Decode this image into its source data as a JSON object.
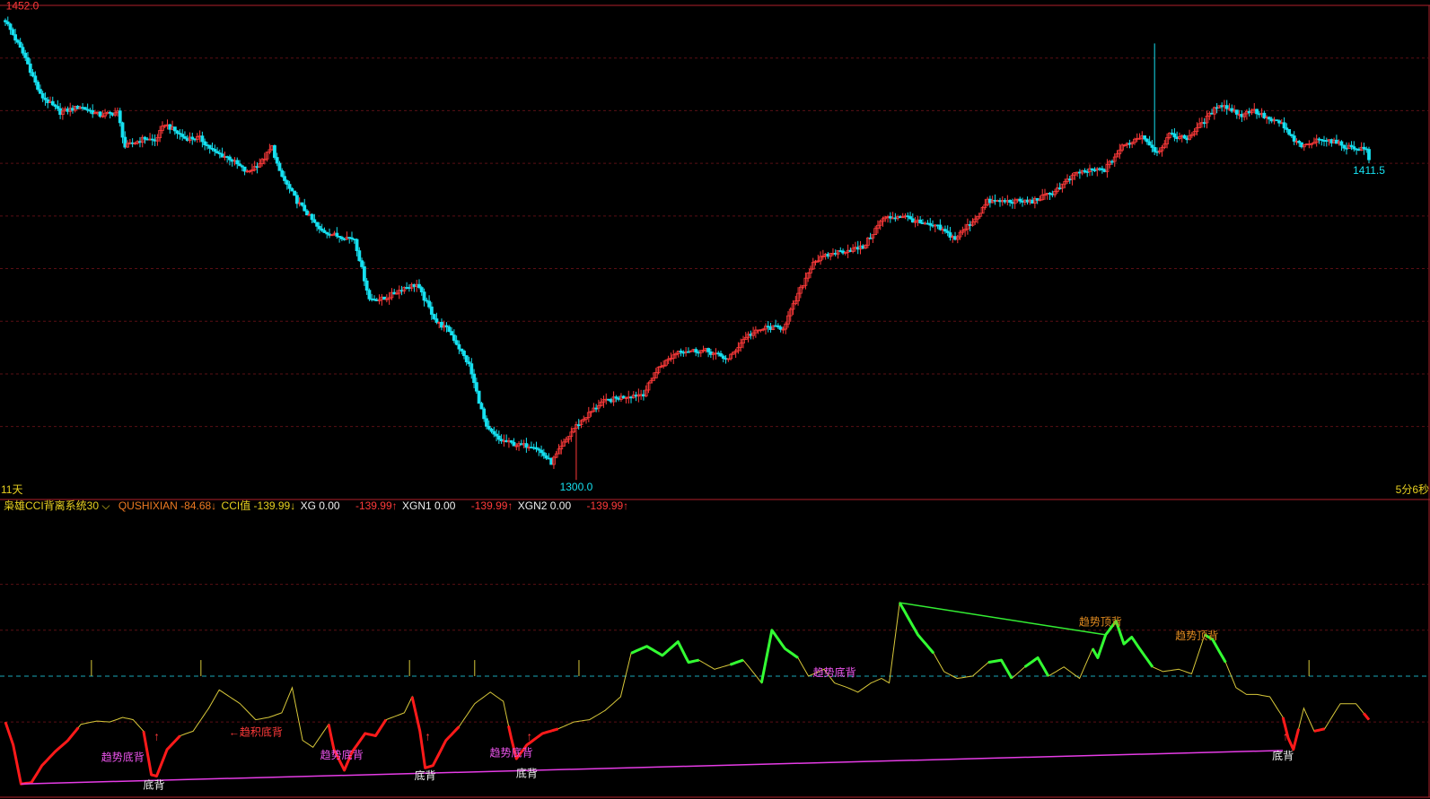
{
  "colors": {
    "background": "#000000",
    "frame": "#b0202a",
    "grid": "#5a0f14",
    "up": "#ff3a3a",
    "down": "#16e0f0",
    "cci_line": "#d8c83a",
    "cci_red": "#ff1a1a",
    "cci_green": "#33ff33",
    "pink_line": "#e63ce6",
    "green_line": "#33ee33",
    "zero_line": "#1aa9b8",
    "label_pink": "#ee55ee",
    "label_orange": "#e08a20",
    "label_white": "#f0f0f0",
    "label_red": "#ff3a3a",
    "label_cyan": "#16e0f0",
    "label_yellow": "#e8d020"
  },
  "main_panel": {
    "period_label": "11天",
    "countdown_label": "5分6秒",
    "high_label": "1452.0",
    "low_label": "1300.0",
    "last_label": "1411.5"
  },
  "indicator_legend": {
    "name": "枭雄CCI背离系统30",
    "items": [
      {
        "text": "QUSHIXIAN -84.68↓",
        "color": "#ee7a22"
      },
      {
        "text": "CCI值 -139.99↓",
        "color": "#e8d020"
      },
      {
        "text": "XG 0.00",
        "color": "#f0f0f0"
      },
      {
        "text": "-139.99↑",
        "color": "#ff3a3a"
      },
      {
        "text": "XGN1 0.00",
        "color": "#f0f0f0"
      },
      {
        "text": "-139.99↑",
        "color": "#ff3a3a"
      },
      {
        "text": "XGN2 0.00",
        "color": "#f0f0f0"
      },
      {
        "text": "-139.99↑",
        "color": "#ff3a3a"
      }
    ]
  },
  "chart_data": [
    {
      "type": "candlestick",
      "ylim": [
        1296,
        1464
      ],
      "high_marker": 1452.0,
      "low_marker": 1300.0,
      "last_marker": 1411.5,
      "anchors": [
        [
          0,
          1460
        ],
        [
          8,
          1447
        ],
        [
          14,
          1434
        ],
        [
          22,
          1428
        ],
        [
          30,
          1430
        ],
        [
          38,
          1427
        ],
        [
          45,
          1428
        ],
        [
          48,
          1416
        ],
        [
          56,
          1419
        ],
        [
          60,
          1418
        ],
        [
          64,
          1424
        ],
        [
          72,
          1419
        ],
        [
          78,
          1419
        ],
        [
          84,
          1414
        ],
        [
          90,
          1412
        ],
        [
          97,
          1407
        ],
        [
          103,
          1411
        ],
        [
          107,
          1416
        ],
        [
          110,
          1407
        ],
        [
          117,
          1397
        ],
        [
          120,
          1394
        ],
        [
          126,
          1387
        ],
        [
          133,
          1385
        ],
        [
          140,
          1384
        ],
        [
          146,
          1363
        ],
        [
          152,
          1363
        ],
        [
          160,
          1367
        ],
        [
          165,
          1368
        ],
        [
          173,
          1355
        ],
        [
          178,
          1352
        ],
        [
          186,
          1340
        ],
        [
          193,
          1318
        ],
        [
          198,
          1314
        ],
        [
          206,
          1312
        ],
        [
          212,
          1312
        ],
        [
          219,
          1306
        ],
        [
          228,
          1318
        ],
        [
          234,
          1323
        ],
        [
          239,
          1327
        ],
        [
          248,
          1329
        ],
        [
          256,
          1330
        ],
        [
          262,
          1339
        ],
        [
          270,
          1345
        ],
        [
          274,
          1345
        ],
        [
          281,
          1345
        ],
        [
          290,
          1342
        ],
        [
          297,
          1350
        ],
        [
          305,
          1353
        ],
        [
          312,
          1353
        ],
        [
          324,
          1376
        ],
        [
          332,
          1379
        ],
        [
          338,
          1380
        ],
        [
          344,
          1381
        ],
        [
          352,
          1391
        ],
        [
          360,
          1392
        ],
        [
          368,
          1389
        ],
        [
          374,
          1388
        ],
        [
          381,
          1384
        ],
        [
          389,
          1391
        ],
        [
          394,
          1397
        ],
        [
          400,
          1397
        ],
        [
          404,
          1397
        ],
        [
          412,
          1397
        ],
        [
          420,
          1400
        ],
        [
          430,
          1407
        ],
        [
          438,
          1408
        ],
        [
          441,
          1408
        ],
        [
          448,
          1416
        ],
        [
          456,
          1420
        ],
        [
          462,
          1414
        ],
        [
          467,
          1420
        ],
        [
          474,
          1419
        ],
        [
          482,
          1426
        ],
        [
          487,
          1431
        ],
        [
          496,
          1427
        ],
        [
          500,
          1429
        ],
        [
          508,
          1425
        ],
        [
          512,
          1424
        ],
        [
          517,
          1418
        ],
        [
          521,
          1416
        ],
        [
          528,
          1419
        ],
        [
          532,
          1418
        ],
        [
          538,
          1416
        ],
        [
          547,
          1415
        ]
      ]
    },
    {
      "type": "line",
      "ylim": [
        -260,
        340
      ],
      "anchors": [
        [
          0,
          -100
        ],
        [
          3,
          -150
        ],
        [
          6,
          -235
        ],
        [
          10,
          -232
        ],
        [
          14,
          -195
        ],
        [
          19,
          -165
        ],
        [
          24,
          -140
        ],
        [
          29,
          -105
        ],
        [
          35,
          -98
        ],
        [
          40,
          -100
        ],
        [
          45,
          -90
        ],
        [
          49,
          -95
        ],
        [
          53,
          -120
        ],
        [
          56,
          -215
        ],
        [
          58,
          -218
        ],
        [
          62,
          -160
        ],
        [
          67,
          -130
        ],
        [
          72,
          -120
        ],
        [
          78,
          -70
        ],
        [
          82,
          -30
        ],
        [
          86,
          -45
        ],
        [
          90,
          -60
        ],
        [
          96,
          -95
        ],
        [
          101,
          -90
        ],
        [
          106,
          -80
        ],
        [
          110,
          -25
        ],
        [
          114,
          -140
        ],
        [
          118,
          -155
        ],
        [
          124,
          -105
        ],
        [
          126,
          -160
        ],
        [
          130,
          -205
        ],
        [
          133,
          -165
        ],
        [
          138,
          -125
        ],
        [
          142,
          -130
        ],
        [
          146,
          -95
        ],
        [
          153,
          -80
        ],
        [
          156,
          -45
        ],
        [
          159,
          -120
        ],
        [
          161,
          -200
        ],
        [
          164,
          -195
        ],
        [
          169,
          -140
        ],
        [
          174,
          -110
        ],
        [
          180,
          -60
        ],
        [
          186,
          -35
        ],
        [
          191,
          -55
        ],
        [
          194,
          -135
        ],
        [
          196,
          -180
        ],
        [
          200,
          -150
        ],
        [
          206,
          -125
        ],
        [
          212,
          -115
        ],
        [
          218,
          -100
        ],
        [
          224,
          -95
        ],
        [
          230,
          -75
        ],
        [
          236,
          -45
        ],
        [
          240,
          50
        ],
        [
          246,
          65
        ],
        [
          252,
          45
        ],
        [
          258,
          75
        ],
        [
          262,
          30
        ],
        [
          266,
          35
        ],
        [
          272,
          15
        ],
        [
          278,
          25
        ],
        [
          283,
          35
        ],
        [
          288,
          0
        ],
        [
          290,
          -15
        ],
        [
          294,
          100
        ],
        [
          299,
          60
        ],
        [
          304,
          40
        ],
        [
          308,
          0
        ],
        [
          314,
          15
        ],
        [
          318,
          -15
        ],
        [
          323,
          -25
        ],
        [
          327,
          -35
        ],
        [
          332,
          -15
        ],
        [
          336,
          -5
        ],
        [
          339,
          -15
        ],
        [
          343,
          160
        ],
        [
          346,
          130
        ],
        [
          350,
          90
        ],
        [
          356,
          50
        ],
        [
          360,
          10
        ],
        [
          365,
          -5
        ],
        [
          371,
          0
        ],
        [
          377,
          30
        ],
        [
          382,
          35
        ],
        [
          386,
          -5
        ],
        [
          391,
          20
        ],
        [
          396,
          40
        ],
        [
          400,
          0
        ],
        [
          406,
          20
        ],
        [
          412,
          -5
        ],
        [
          417,
          60
        ],
        [
          419,
          40
        ],
        [
          422,
          90
        ],
        [
          426,
          120
        ],
        [
          429,
          70
        ],
        [
          432,
          85
        ],
        [
          435,
          60
        ],
        [
          440,
          20
        ],
        [
          444,
          10
        ],
        [
          450,
          15
        ],
        [
          455,
          5
        ],
        [
          460,
          90
        ],
        [
          463,
          80
        ],
        [
          468,
          30
        ],
        [
          472,
          -25
        ],
        [
          476,
          -40
        ],
        [
          480,
          -40
        ],
        [
          485,
          -45
        ],
        [
          490,
          -90
        ],
        [
          492,
          -135
        ],
        [
          494,
          -160
        ],
        [
          498,
          -70
        ],
        [
          502,
          -120
        ],
        [
          506,
          -115
        ],
        [
          512,
          -60
        ],
        [
          518,
          -60
        ],
        [
          523,
          -95
        ]
      ],
      "signal_segments": [
        {
          "color": "red",
          "from": 0,
          "to": 28
        },
        {
          "color": "red",
          "from": 53,
          "to": 67
        },
        {
          "color": "red",
          "from": 124,
          "to": 146
        },
        {
          "color": "red",
          "from": 156,
          "to": 174
        },
        {
          "color": "red",
          "from": 193,
          "to": 212
        },
        {
          "color": "red",
          "from": 490,
          "to": 496
        },
        {
          "color": "red",
          "from": 502,
          "to": 506
        },
        {
          "color": "red",
          "from": 521,
          "to": 523
        },
        {
          "color": "green",
          "from": 240,
          "to": 266
        },
        {
          "color": "green",
          "from": 278,
          "to": 283
        },
        {
          "color": "green",
          "from": 290,
          "to": 304
        },
        {
          "color": "green",
          "from": 343,
          "to": 356
        },
        {
          "color": "green",
          "from": 377,
          "to": 386
        },
        {
          "color": "green",
          "from": 391,
          "to": 400
        },
        {
          "color": "green",
          "from": 417,
          "to": 440
        },
        {
          "color": "green",
          "from": 460,
          "to": 468
        }
      ],
      "vertical_markers": [
        33,
        75,
        155,
        180,
        220,
        500
      ],
      "pink_trendline": [
        [
          6,
          -235
        ],
        [
          490,
          -162
        ]
      ],
      "green_trendline": [
        [
          343,
          160
        ],
        [
          422,
          90
        ]
      ],
      "annotations": [
        {
          "text": "趋势底背",
          "color_key": "label_pink",
          "x": 45,
          "y": -185
        },
        {
          "text": "底背",
          "color_key": "label_white",
          "x": 57,
          "y": -245
        },
        {
          "text": "↑",
          "color_key": "label_red",
          "x": 58,
          "y": -140
        },
        {
          "text": "←趋积底背",
          "color_key": "label_red",
          "x": 96,
          "y": -130
        },
        {
          "text": "趋势底背",
          "color_key": "label_pink",
          "x": 129,
          "y": -180
        },
        {
          "text": "底背",
          "color_key": "label_white",
          "x": 161,
          "y": -225
        },
        {
          "text": "↑",
          "color_key": "label_red",
          "x": 162,
          "y": -140
        },
        {
          "text": "趋势底背",
          "color_key": "label_pink",
          "x": 194,
          "y": -175
        },
        {
          "text": "底背",
          "color_key": "label_white",
          "x": 200,
          "y": -220
        },
        {
          "text": "↑",
          "color_key": "label_red",
          "x": 201,
          "y": -140
        },
        {
          "text": "趋势底背",
          "color_key": "label_pink",
          "x": 318,
          "y": 0
        },
        {
          "text": "趋势顶背",
          "color_key": "label_orange",
          "x": 420,
          "y": 110
        },
        {
          "text": "趋势顶背",
          "color_key": "label_orange",
          "x": 457,
          "y": 80
        },
        {
          "text": "底背",
          "color_key": "label_white",
          "x": 490,
          "y": -182
        },
        {
          "text": "↑",
          "color_key": "label_red",
          "x": 491,
          "y": -140
        }
      ]
    }
  ]
}
